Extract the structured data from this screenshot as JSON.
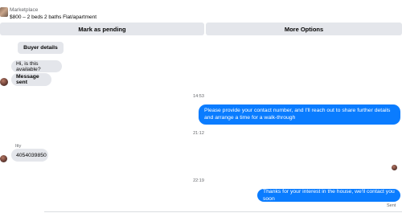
{
  "listing": {
    "category": "Marketplace",
    "title": "$800 – 2 beds 2 baths Flat/apartment"
  },
  "actions": {
    "mark_pending": "Mark as pending",
    "more_options": "More Options"
  },
  "chat": {
    "buyer_details": "Buyer details",
    "incoming_1": "Hi, is this available?",
    "incoming_2": "Message sent",
    "time_1": "14:53",
    "outgoing_1": "Please provide your contact number, and I'll reach out to share further details and arrange a time for a walk-through",
    "time_2": "21:12",
    "sender_name": "Itty",
    "incoming_3": "4054039850",
    "time_3": "22:19",
    "outgoing_2": "Thanks for your interest in the house, we'll contact you soon",
    "status": "Sent"
  },
  "colors": {
    "outgoing_bubble": "#0a7cff",
    "incoming_bubble": "#e4e6eb",
    "button_bg": "#e4e6eb",
    "muted_text": "#65676b"
  }
}
